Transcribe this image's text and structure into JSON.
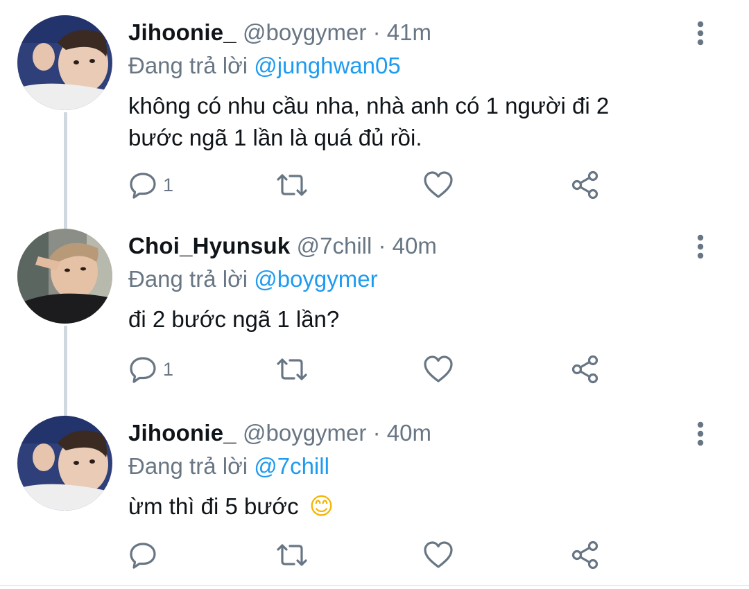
{
  "tweets": [
    {
      "name": "Jihoonie_",
      "handle": "@boygymer",
      "separator": "·",
      "time": "41m",
      "reply_prefix": "Đang trả lời",
      "reply_mention": "@junghwan05",
      "text_line1": "không có nhu cầu nha, nhà anh có 1 người đi 2",
      "text_line2": "bước ngã 1 lần là quá đủ rồi.",
      "reply_count": "1",
      "avatar": "avatar-photo"
    },
    {
      "name": "Choi_Hyunsuk",
      "handle": "@7chill",
      "separator": "·",
      "time": "40m",
      "reply_prefix": "Đang trả lời",
      "reply_mention": "@boygymer",
      "text_line1": "đi 2 bước ngã 1 lần?",
      "reply_count": "1",
      "avatar": "avatar-photo"
    },
    {
      "name": "Jihoonie_",
      "handle": "@boygymer",
      "separator": "·",
      "time": "40m",
      "reply_prefix": "Đang trả lời",
      "reply_mention": "@7chill",
      "text_line1": "ừm thì đi 5 bước",
      "emoji": "😊",
      "reply_count": "",
      "avatar": "avatar-photo"
    }
  ],
  "icons": {
    "reply": "reply-icon",
    "retweet": "retweet-icon",
    "like": "heart-icon",
    "share": "share-icon",
    "more": "more-vertical-icon"
  },
  "colors": {
    "text": "#0f1419",
    "secondary": "#687684",
    "link": "#1d9bf0",
    "connector": "#cfd9de"
  }
}
